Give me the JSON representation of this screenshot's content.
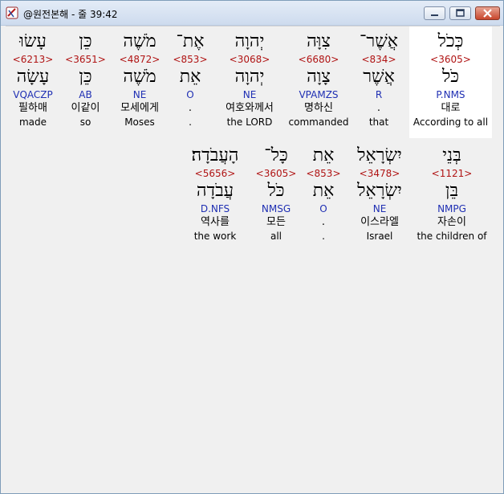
{
  "window": {
    "title": "@원전본해 - 줄 39:42"
  },
  "lines": [
    {
      "words": [
        {
          "hebrew": "כְּכֹל",
          "strong": "<3605>",
          "lemma": "כֹּל",
          "parse": "P.NMS",
          "korean": "대로",
          "english": "According to all",
          "highlight": true
        },
        {
          "hebrew": "אֲשֶׁר־",
          "strong": "<834>",
          "lemma": "אֲשֶׁר",
          "parse": "R",
          "korean": ".",
          "english": "that"
        },
        {
          "hebrew": "צִוָּה",
          "strong": "<6680>",
          "lemma": "צָוָה",
          "parse": "VPAMZS",
          "korean": "명하신",
          "english": "commanded"
        },
        {
          "hebrew": "יְהוָה",
          "strong": "<3068>",
          "lemma": "יְהוָה",
          "parse": "NE",
          "korean": "여호와께서",
          "english": "the LORD"
        },
        {
          "hebrew": "אֶת־",
          "strong": "<853>",
          "lemma": "אֵת",
          "parse": "O",
          "korean": ".",
          "english": "."
        },
        {
          "hebrew": "מֹשֶׁה",
          "strong": "<4872>",
          "lemma": "מֹשֶׁה",
          "parse": "NE",
          "korean": "모세에게",
          "english": "Moses"
        },
        {
          "hebrew": "כֵּן",
          "strong": "<3651>",
          "lemma": "כֵּן",
          "parse": "AB",
          "korean": "이같이",
          "english": "so"
        },
        {
          "hebrew": "עָשׂוּ",
          "strong": "<6213>",
          "lemma": "עָשָׂה",
          "parse": "VQACZP",
          "korean": "필하매",
          "english": "made"
        }
      ]
    },
    {
      "words": [
        {
          "hebrew": "בְּנֵי",
          "strong": "<1121>",
          "lemma": "בֵּן",
          "parse": "NMPG",
          "korean": "자손이",
          "english": "the children of"
        },
        {
          "hebrew": "יִשְׂרָאֵל",
          "strong": "<3478>",
          "lemma": "יִשְׂרָאֵל",
          "parse": "NE",
          "korean": "이스라엘",
          "english": "Israel"
        },
        {
          "hebrew": "אֵת",
          "strong": "<853>",
          "lemma": "אֵת",
          "parse": "O",
          "korean": ".",
          "english": "."
        },
        {
          "hebrew": "כָּל־",
          "strong": "<3605>",
          "lemma": "כֹּל",
          "parse": "NMSG",
          "korean": "모든",
          "english": "all"
        },
        {
          "hebrew": "הָעֲבֹדָה׃",
          "strong": "<5656>",
          "lemma": "עֲבֹדָה",
          "parse": "D.NFS",
          "korean": "역사를",
          "english": "the work"
        }
      ]
    }
  ]
}
